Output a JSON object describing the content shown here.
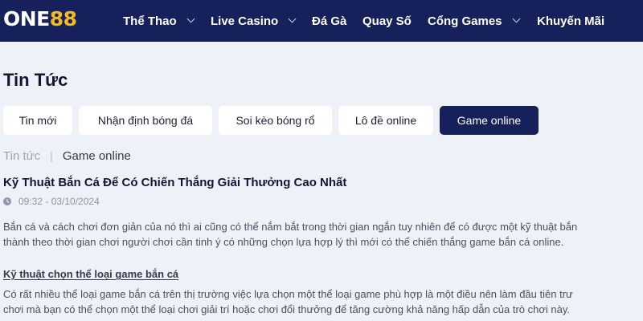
{
  "brand": {
    "logo_part1": "ONE",
    "logo_part2": "88"
  },
  "nav": {
    "items": [
      {
        "label": "Thể Thao"
      },
      {
        "label": "Live Casino"
      },
      {
        "label": "Đá Gà"
      },
      {
        "label": "Quay Số"
      },
      {
        "label": "Cổng Games"
      },
      {
        "label": "Khuyến Mãi"
      }
    ]
  },
  "page": {
    "title": "Tin Tức"
  },
  "tabs": {
    "active": "Game online",
    "items": [
      {
        "label": "Tin mới"
      },
      {
        "label": "Nhận định bóng đá"
      },
      {
        "label": "Soi kèo bóng rổ"
      },
      {
        "label": "Lô đề online"
      },
      {
        "label": "Game online"
      }
    ]
  },
  "breadcrumb": {
    "root": "Tin tức",
    "separator": "|",
    "current": "Game online"
  },
  "article": {
    "title": "Kỹ Thuật Bắn Cá Để Có Chiến Thắng Giải Thưởng Cao Nhất",
    "datetime": "09:32 - 03/10/2024",
    "intro_lines": [
      "Bắn cá và cách chơi đơn giản của nó thì ai cũng có thể nắm bắt trong thời gian ngắn tuy nhiên để có được một kỹ thuật bắn",
      "thành theo thời gian chơi người chơi cần tinh ý có những chọn lựa hợp lý thì mới có thể chiến thắng game bắn cá online."
    ],
    "section_heading": "Kỹ thuật chọn thể loại game bắn cá",
    "section_lines": [
      "Có rất nhiều thể loại game bắn cá trên thị trường việc lựa chọn một thể loại game phù hợp là một điều nên làm đầu tiên trư",
      "chơi mà bạn có thể chọn một thể loại chơi giải trí hoặc chơi đổi thưởng để tăng cường khả năng hấp dẫn của trò chơi này."
    ]
  },
  "colors": {
    "header_bg": "#16205a",
    "page_bg": "#eef1f8",
    "accent_gold": "#f5b820",
    "tab_active_bg": "#16205a"
  }
}
